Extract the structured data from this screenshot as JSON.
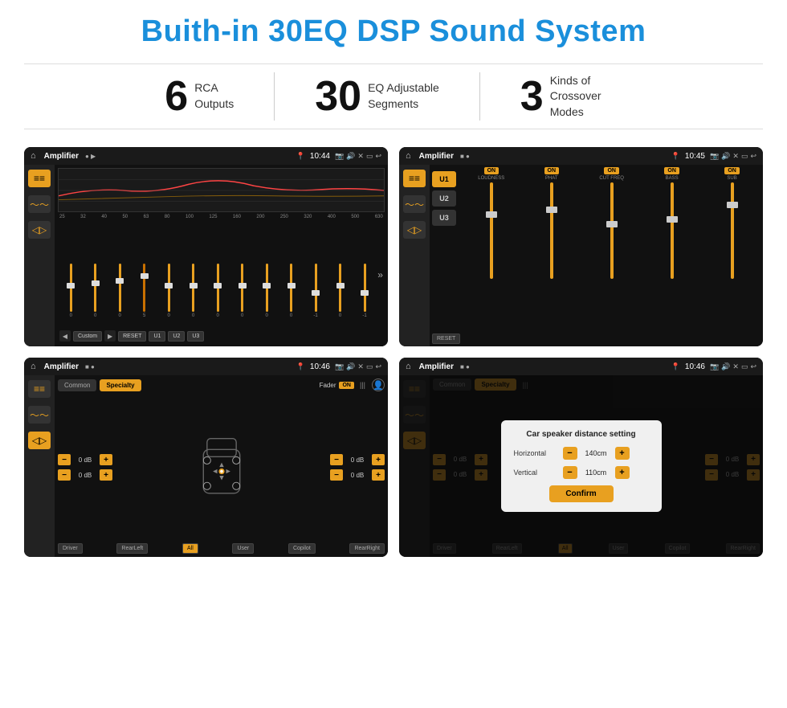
{
  "page": {
    "title": "Buith-in 30EQ DSP Sound System"
  },
  "stats": [
    {
      "number": "6",
      "desc_line1": "RCA",
      "desc_line2": "Outputs"
    },
    {
      "number": "30",
      "desc_line1": "EQ Adjustable",
      "desc_line2": "Segments"
    },
    {
      "number": "3",
      "desc_line1": "Kinds of",
      "desc_line2": "Crossover Modes"
    }
  ],
  "screens": [
    {
      "id": "eq-screen",
      "app_name": "Amplifier",
      "time": "10:44",
      "type": "eq"
    },
    {
      "id": "crossover-screen",
      "app_name": "Amplifier",
      "time": "10:45",
      "type": "crossover",
      "u_buttons": [
        "U1",
        "U2",
        "U3"
      ],
      "channels": [
        {
          "label": "LOUDNESS",
          "on": true
        },
        {
          "label": "PHAT",
          "on": true
        },
        {
          "label": "CUT FREQ",
          "on": true
        },
        {
          "label": "BASS",
          "on": true
        },
        {
          "label": "SUB",
          "on": true
        }
      ],
      "reset_label": "RESET"
    },
    {
      "id": "fader-screen",
      "app_name": "Amplifier",
      "time": "10:46",
      "type": "fader",
      "tabs": [
        "Common",
        "Specialty"
      ],
      "active_tab": "Specialty",
      "fader_label": "Fader",
      "on_badge": "ON",
      "db_values": [
        "0 dB",
        "0 dB",
        "0 dB",
        "0 dB"
      ],
      "zones": [
        "Driver",
        "RearLeft",
        "All",
        "User",
        "Copilot",
        "RearRight"
      ]
    },
    {
      "id": "dialog-screen",
      "app_name": "Amplifier",
      "time": "10:46",
      "type": "dialog",
      "tabs": [
        "Common",
        "Specialty"
      ],
      "dialog": {
        "title": "Car speaker distance setting",
        "rows": [
          {
            "label": "Horizontal",
            "value": "140cm"
          },
          {
            "label": "Vertical",
            "value": "110cm"
          }
        ],
        "confirm_label": "Confirm"
      }
    }
  ],
  "eq_freqs": [
    "25",
    "32",
    "40",
    "50",
    "63",
    "80",
    "100",
    "125",
    "160",
    "200",
    "250",
    "320",
    "400",
    "500",
    "630"
  ],
  "eq_values": [
    "0",
    "0",
    "0",
    "5",
    "0",
    "0",
    "0",
    "0",
    "0",
    "0",
    "-1",
    "0",
    "-1"
  ],
  "eq_buttons": [
    "Custom",
    "RESET",
    "U1",
    "U2",
    "U3"
  ]
}
